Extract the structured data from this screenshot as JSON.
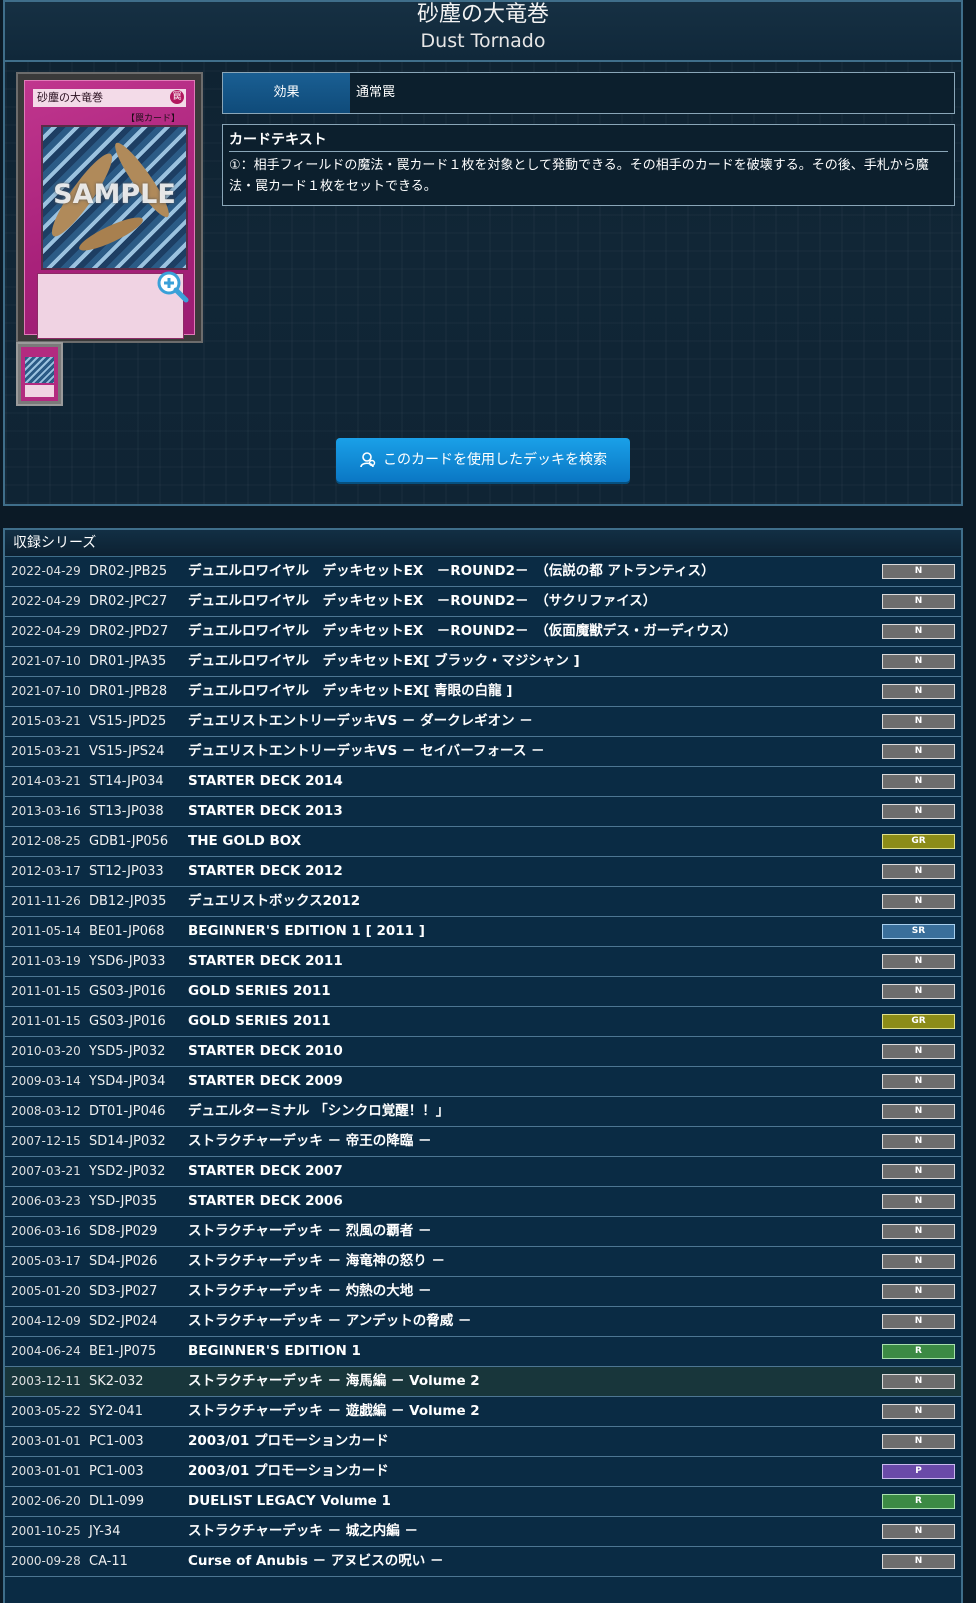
{
  "card": {
    "name_jp": "砂塵の大竜巻",
    "name_en": "Dust Tornado",
    "image_name": "砂塵の大竜巻",
    "image_attr": "罠",
    "image_type": "【罠カード】",
    "image_watermark": "SAMPLE",
    "effect_label": "効果",
    "effect_value": "通常罠",
    "text_heading": "カードテキスト",
    "text_body": "①：相手フィールドの魔法・罠カード１枚を対象として発動できる。その相手のカードを破壊する。その後、手札から魔法・罠カード１枚をセットできる。",
    "deck_search_button": "このカードを使用したデッキを検索"
  },
  "series": {
    "heading": "収録シリーズ",
    "rows": [
      {
        "date": "2022-04-29",
        "code": "DR02-JPB25",
        "name": "デュエルロワイヤル　デッキセットEX　－ROUND2－　（伝説の都 アトランティス）",
        "rarity": "N"
      },
      {
        "date": "2022-04-29",
        "code": "DR02-JPC27",
        "name": "デュエルロワイヤル　デッキセットEX　－ROUND2－　（サクリファイス）",
        "rarity": "N"
      },
      {
        "date": "2022-04-29",
        "code": "DR02-JPD27",
        "name": "デュエルロワイヤル　デッキセットEX　－ROUND2－　（仮面魔獣デス・ガーディウス）",
        "rarity": "N"
      },
      {
        "date": "2021-07-10",
        "code": "DR01-JPA35",
        "name": "デュエルロワイヤル　デッキセットEX[ ブラック・マジシャン ]",
        "rarity": "N"
      },
      {
        "date": "2021-07-10",
        "code": "DR01-JPB28",
        "name": "デュエルロワイヤル　デッキセットEX[ 青眼の白龍 ]",
        "rarity": "N"
      },
      {
        "date": "2015-03-21",
        "code": "VS15-JPD25",
        "name": "デュエリストエントリーデッキVS － ダークレギオン －",
        "rarity": "N"
      },
      {
        "date": "2015-03-21",
        "code": "VS15-JPS24",
        "name": "デュエリストエントリーデッキVS － セイバーフォース －",
        "rarity": "N"
      },
      {
        "date": "2014-03-21",
        "code": "ST14-JP034",
        "name": "STARTER DECK 2014",
        "rarity": "N"
      },
      {
        "date": "2013-03-16",
        "code": "ST13-JP038",
        "name": "STARTER DECK 2013",
        "rarity": "N"
      },
      {
        "date": "2012-08-25",
        "code": "GDB1-JP056",
        "name": "THE GOLD BOX",
        "rarity": "GR"
      },
      {
        "date": "2012-03-17",
        "code": "ST12-JP033",
        "name": "STARTER DECK 2012",
        "rarity": "N"
      },
      {
        "date": "2011-11-26",
        "code": "DB12-JP035",
        "name": "デュエリストボックス2012",
        "rarity": "N"
      },
      {
        "date": "2011-05-14",
        "code": "BE01-JP068",
        "name": "BEGINNER'S EDITION 1 [ 2011 ]",
        "rarity": "SR"
      },
      {
        "date": "2011-03-19",
        "code": "YSD6-JP033",
        "name": "STARTER DECK 2011",
        "rarity": "N"
      },
      {
        "date": "2011-01-15",
        "code": "GS03-JP016",
        "name": "GOLD SERIES 2011",
        "rarity": "N"
      },
      {
        "date": "2011-01-15",
        "code": "GS03-JP016",
        "name": "GOLD SERIES 2011",
        "rarity": "GR"
      },
      {
        "date": "2010-03-20",
        "code": "YSD5-JP032",
        "name": "STARTER DECK 2010",
        "rarity": "N"
      },
      {
        "date": "2009-03-14",
        "code": "YSD4-JP034",
        "name": "STARTER DECK 2009",
        "rarity": "N"
      },
      {
        "date": "2008-03-12",
        "code": "DT01-JP046",
        "name": "デュエルターミナル 「シンクロ覚醒！！」",
        "rarity": "N"
      },
      {
        "date": "2007-12-15",
        "code": "SD14-JP032",
        "name": "ストラクチャーデッキ － 帝王の降臨 －",
        "rarity": "N"
      },
      {
        "date": "2007-03-21",
        "code": "YSD2-JP032",
        "name": "STARTER DECK 2007",
        "rarity": "N"
      },
      {
        "date": "2006-03-23",
        "code": "YSD-JP035",
        "name": "STARTER DECK 2006",
        "rarity": "N"
      },
      {
        "date": "2006-03-16",
        "code": "SD8-JP029",
        "name": "ストラクチャーデッキ － 烈風の覇者 －",
        "rarity": "N"
      },
      {
        "date": "2005-03-17",
        "code": "SD4-JP026",
        "name": "ストラクチャーデッキ － 海竜神の怒り －",
        "rarity": "N"
      },
      {
        "date": "2005-01-20",
        "code": "SD3-JP027",
        "name": "ストラクチャーデッキ － 灼熱の大地 －",
        "rarity": "N"
      },
      {
        "date": "2004-12-09",
        "code": "SD2-JP024",
        "name": "ストラクチャーデッキ － アンデットの脅威 －",
        "rarity": "N"
      },
      {
        "date": "2004-06-24",
        "code": "BE1-JP075",
        "name": "BEGINNER'S EDITION 1",
        "rarity": "R"
      },
      {
        "date": "2003-12-11",
        "code": "SK2-032",
        "name": "ストラクチャーデッキ － 海馬編 － Volume 2",
        "rarity": "N"
      },
      {
        "date": "2003-05-22",
        "code": "SY2-041",
        "name": "ストラクチャーデッキ － 遊戯編 － Volume 2",
        "rarity": "N"
      },
      {
        "date": "2003-01-01",
        "code": "PC1-003",
        "name": "2003/01 プロモーションカード",
        "rarity": "N"
      },
      {
        "date": "2003-01-01",
        "code": "PC1-003",
        "name": "2003/01 プロモーションカード",
        "rarity": "P"
      },
      {
        "date": "2002-06-20",
        "code": "DL1-099",
        "name": "DUELIST LEGACY Volume 1",
        "rarity": "R"
      },
      {
        "date": "2001-10-25",
        "code": "JY-34",
        "name": "ストラクチャーデッキ － 城之内編 －",
        "rarity": "N"
      },
      {
        "date": "2000-09-28",
        "code": "CA-11",
        "name": "Curse of Anubis － アヌビスの呪い －",
        "rarity": "N"
      }
    ]
  }
}
